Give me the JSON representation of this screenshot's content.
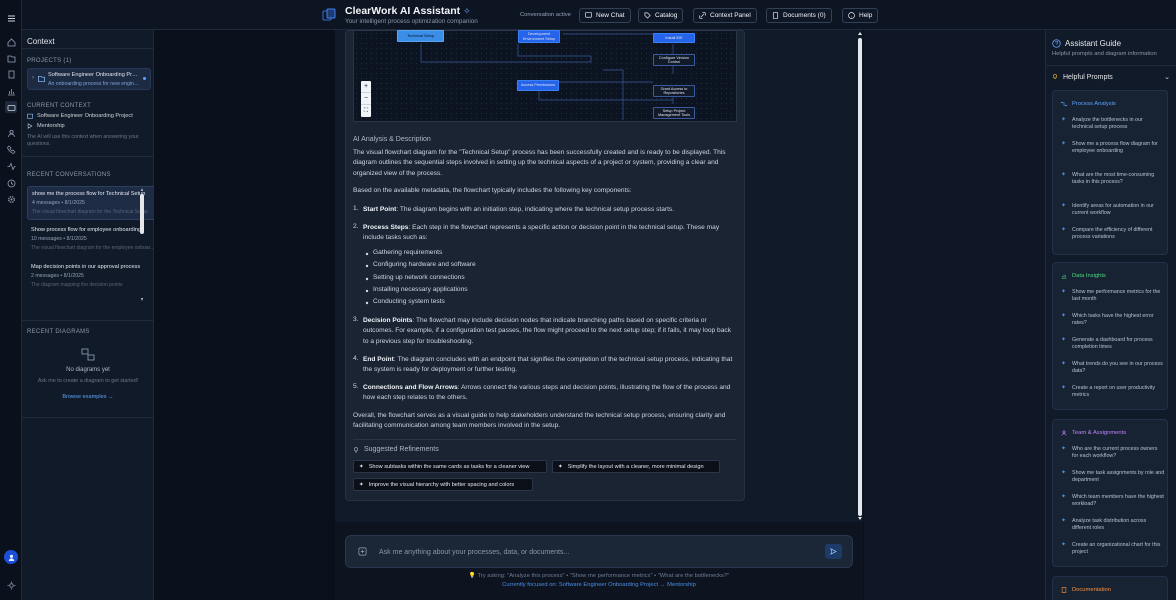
{
  "app": {
    "title": "ClearWork AI Assistant",
    "subtitle": "Your intelligent process optimization companion",
    "status": "Conversation active"
  },
  "toolbar": {
    "new_chat": "New Chat",
    "catalog": "Catalog",
    "context_panel": "Context Panel",
    "documents": "Documents (0)",
    "help": "Help"
  },
  "context": {
    "title": "Context",
    "projects_label": "PROJECTS (1)",
    "project": {
      "name": "Software Engineer Onboarding Project",
      "desc": "An onboarding process for new engineers"
    },
    "current_context_label": "CURRENT CONTEXT",
    "current_project": "Software Engineer Onboarding Project",
    "current_process": "Mentorship",
    "note": "The AI will use this context when answering your questions.",
    "recent_conversations_label": "RECENT CONVERSATIONS",
    "conversations": [
      {
        "title": "show me the process flow for Technical Setup",
        "meta": "4 messages • 8/1/2025",
        "preview": "The visual flowchart diagram for the Technical Setup"
      },
      {
        "title": "Show process flow for employee onboarding",
        "meta": "10 messages • 8/1/2025",
        "preview": "The visual flowchart diagram for the employee onboarding"
      },
      {
        "title": "Map decision points in our approval process",
        "meta": "2 messages • 8/1/2025",
        "preview": "The diagram mapping the decision points"
      }
    ],
    "recent_diagrams_label": "RECENT DIAGRAMS",
    "no_diagrams": "No diagrams yet",
    "diagrams_hint": "Ask me to create a diagram to get started!",
    "browse": "Browse examples →"
  },
  "diagram": {
    "nodes": {
      "technical_setup": "Technical Setup",
      "dev_env": "Development Environment Setup",
      "install_ide": "Install IDE",
      "configure_vc": "Configure Version Control",
      "access_permissions": "Access Permissions",
      "grant_access": "Grant Access to Repositories",
      "setup_pm": "Setup Project Management Tools"
    },
    "zoom": {
      "in": "+",
      "out": "−",
      "fit": "⛶"
    }
  },
  "message": {
    "section_title": "AI Analysis & Description",
    "intro": "The visual flowchart diagram for the \"Technical Setup\" process has been successfully created and is ready to be displayed. This diagram outlines the sequential steps involved in setting up the technical aspects of a project or system, providing a clear and organized view of the process.",
    "lead": "Based on the available metadata, the flowchart typically includes the following key components:",
    "items": [
      {
        "num": "1.",
        "term": "Start Point",
        "text": ": The diagram begins with an initiation step, indicating where the technical setup process starts."
      },
      {
        "num": "2.",
        "term": "Process Steps",
        "text": ": Each step in the flowchart represents a specific action or decision point in the technical setup. These may include tasks such as:"
      },
      {
        "num": "3.",
        "term": "Decision Points",
        "text": ": The flowchart may include decision nodes that indicate branching paths based on specific criteria or outcomes. For example, if a configuration test passes, the flow might proceed to the next setup step; if it fails, it may loop back to a previous step for troubleshooting."
      },
      {
        "num": "4.",
        "term": "End Point",
        "text": ": The diagram concludes with an endpoint that signifies the completion of the technical setup process, indicating that the system is ready for deployment or further testing."
      },
      {
        "num": "5.",
        "term": "Connections and Flow Arrows",
        "text": ": Arrows connect the various steps and decision points, illustrating the flow of the process and how each step relates to the others."
      }
    ],
    "subitems": [
      "Gathering requirements",
      "Configuring hardware and software",
      "Setting up network connections",
      "Installing necessary applications",
      "Conducting system tests"
    ],
    "overall": "Overall, the flowchart serves as a visual guide to help stakeholders understand the technical setup process, ensuring clarity and facilitating communication among team members involved in the setup.",
    "suggested_label": "Suggested Refinements",
    "suggestions": [
      "Show subtasks within the same cards as tasks for a cleaner view",
      "Simplify the layout with a cleaner, more minimal design",
      "Improve the visual hierarchy with better spacing and colors"
    ]
  },
  "composer": {
    "placeholder": "Ask me anything about your processes, data, or documents...",
    "tip": "💡 Try asking: \"Analyze this process\" • \"Show me performance metrics\" • \"What are the bottlenecks?\"",
    "focus": "Currently focused on: Software Engineer Onboarding Project → Mentorship"
  },
  "guide": {
    "title": "Assistant Guide",
    "subtitle": "Helpful prompts and diagram information",
    "prompts_label": "Helpful Prompts",
    "sections": [
      {
        "name": "Process Analysis",
        "color": "#60a5fa",
        "questions": [
          "Analyze the bottlenecks in our technical setup process",
          "Show me a process flow diagram for employee onboarding",
          "What are the most time-consuming tasks in this process?",
          "Identify areas for automation in our current workflow",
          "Compare the efficiency of different process variations"
        ]
      },
      {
        "name": "Data Insights",
        "color": "#4ade80",
        "questions": [
          "Show me performance metrics for the last month",
          "Which tasks have the highest error rates?",
          "Generate a dashboard for process completion times",
          "What trends do you see in our process data?",
          "Create a report on user productivity metrics"
        ]
      },
      {
        "name": "Team & Assignments",
        "color": "#c084fc",
        "questions": [
          "Who are the current process owners for each workflow?",
          "Show me task assignments by role and department",
          "Which team members have the highest workload?",
          "Analyze task distribution across different roles",
          "Create an organizational chart for this project"
        ]
      },
      {
        "name": "Documentation",
        "color": "#fb923c",
        "questions": []
      }
    ]
  },
  "colors": {
    "accent": "#3b82f6",
    "bg": "#0a101b",
    "panel": "#111a28"
  }
}
